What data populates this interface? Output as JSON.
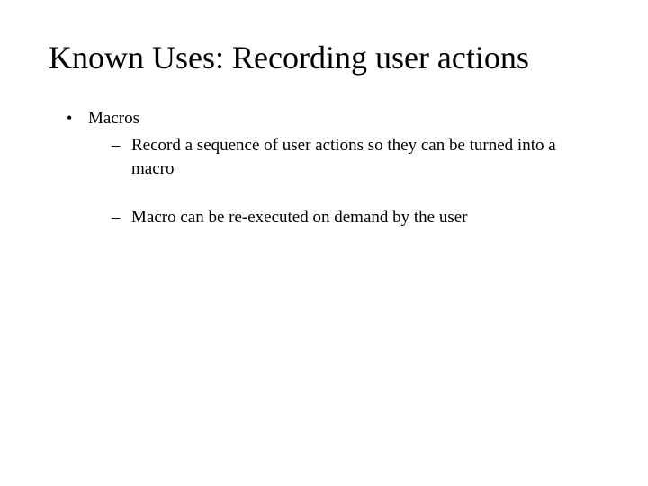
{
  "slide": {
    "title": "Known Uses: Recording user actions",
    "bullets": [
      {
        "text": "Macros",
        "sub": [
          "Record a sequence of user actions so they can be turned into a macro",
          "Macro can be re-executed on demand by the user"
        ]
      }
    ]
  }
}
